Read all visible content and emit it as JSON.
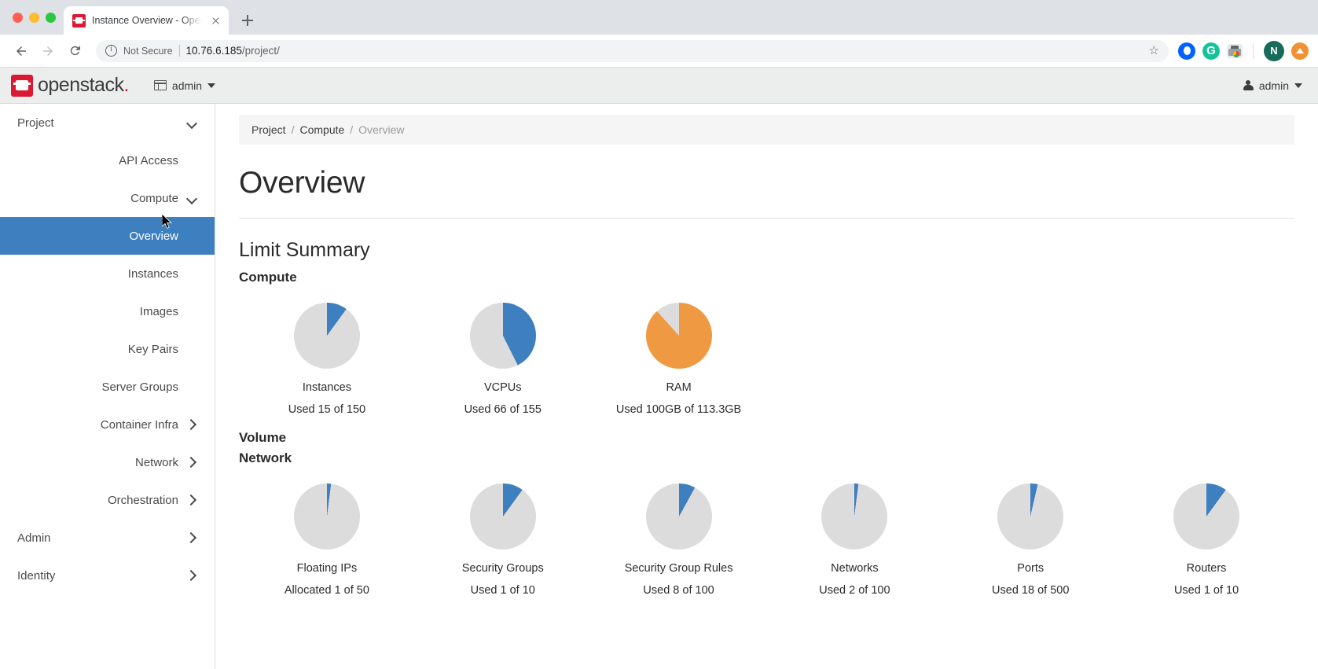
{
  "browser": {
    "tab": {
      "title": "Instance Overview - OpenStack",
      "favicon_name": "openstack-favicon",
      "close_label": "Close tab"
    },
    "new_tab_label": "New Tab",
    "toolbar": {
      "back_label": "Back",
      "forward_label": "Forward",
      "reload_label": "Reload",
      "security_text": "Not Secure",
      "url_host": "10.76.6.185",
      "url_path": "/project/",
      "bookmark_label": "Bookmark this tab",
      "extensions": [
        {
          "name": "opera-extension-icon",
          "label": "Opera"
        },
        {
          "name": "grammarly-extension-icon",
          "label": "G"
        },
        {
          "name": "print-friendly-extension-icon",
          "label": "Print"
        }
      ],
      "profile_initial": "N",
      "update_label": "Update"
    }
  },
  "app_header": {
    "logo_text": "openstack",
    "logo_dot": ".",
    "project_switcher": "admin",
    "user_menu": "admin"
  },
  "sidebar": {
    "items": [
      {
        "label": "Project",
        "level": 0,
        "icon": "chevron-down-icon",
        "active": false,
        "name": "sidebar-item-project"
      },
      {
        "label": "API Access",
        "level": 1,
        "icon": "none",
        "active": false,
        "name": "sidebar-item-api-access"
      },
      {
        "label": "Compute",
        "level": 1,
        "icon": "chevron-down-icon",
        "active": false,
        "name": "sidebar-item-compute"
      },
      {
        "label": "Overview",
        "level": 2,
        "icon": "none",
        "active": true,
        "name": "sidebar-item-overview"
      },
      {
        "label": "Instances",
        "level": 2,
        "icon": "none",
        "active": false,
        "name": "sidebar-item-instances"
      },
      {
        "label": "Images",
        "level": 2,
        "icon": "none",
        "active": false,
        "name": "sidebar-item-images"
      },
      {
        "label": "Key Pairs",
        "level": 2,
        "icon": "none",
        "active": false,
        "name": "sidebar-item-key-pairs"
      },
      {
        "label": "Server Groups",
        "level": 2,
        "icon": "none",
        "active": false,
        "name": "sidebar-item-server-groups"
      },
      {
        "label": "Container Infra",
        "level": 1,
        "icon": "chevron-right-icon",
        "active": false,
        "name": "sidebar-item-container-infra"
      },
      {
        "label": "Network",
        "level": 1,
        "icon": "chevron-right-icon",
        "active": false,
        "name": "sidebar-item-network"
      },
      {
        "label": "Orchestration",
        "level": 1,
        "icon": "chevron-right-icon",
        "active": false,
        "name": "sidebar-item-orchestration"
      },
      {
        "label": "Admin",
        "level": 0,
        "icon": "chevron-right-icon",
        "active": false,
        "name": "sidebar-item-admin"
      },
      {
        "label": "Identity",
        "level": 0,
        "icon": "chevron-right-icon",
        "active": false,
        "name": "sidebar-item-identity"
      }
    ]
  },
  "breadcrumb": {
    "items": [
      "Project",
      "Compute",
      "Overview"
    ],
    "separator": "/"
  },
  "page": {
    "title": "Overview",
    "limit_summary_title": "Limit Summary",
    "sections": {
      "compute": "Compute",
      "volume": "Volume",
      "network": "Network"
    }
  },
  "colors": {
    "used_blue": "#3d7fbf",
    "used_orange": "#ef9a42",
    "remaining_gray": "#dcdcdc",
    "active_nav": "#3d7fbf"
  },
  "chart_data": [
    {
      "type": "pie",
      "title": "Compute",
      "charts": [
        {
          "label": "Instances",
          "usage_text": "Used 15 of 150",
          "used": 15,
          "total": 150,
          "percent": 10.0,
          "color": "#3d7fbf"
        },
        {
          "label": "VCPUs",
          "usage_text": "Used 66 of 155",
          "used": 66,
          "total": 155,
          "percent": 42.6,
          "color": "#3d7fbf"
        },
        {
          "label": "RAM",
          "usage_text": "Used 100GB of 113.3GB",
          "used": 100,
          "total": 113.3,
          "percent": 88.3,
          "color": "#ef9a42"
        }
      ]
    },
    {
      "type": "pie",
      "title": "Volume",
      "charts": []
    },
    {
      "type": "pie",
      "title": "Network",
      "charts": [
        {
          "label": "Floating IPs",
          "usage_text": "Allocated 1 of 50",
          "used": 1,
          "total": 50,
          "percent": 2.0,
          "color": "#3d7fbf"
        },
        {
          "label": "Security Groups",
          "usage_text": "Used 1 of 10",
          "used": 1,
          "total": 10,
          "percent": 10.0,
          "color": "#3d7fbf"
        },
        {
          "label": "Security Group Rules",
          "usage_text": "Used 8 of 100",
          "used": 8,
          "total": 100,
          "percent": 8.0,
          "color": "#3d7fbf"
        },
        {
          "label": "Networks",
          "usage_text": "Used 2 of 100",
          "used": 2,
          "total": 100,
          "percent": 2.0,
          "color": "#3d7fbf"
        },
        {
          "label": "Ports",
          "usage_text": "Used 18 of 500",
          "used": 18,
          "total": 500,
          "percent": 3.6,
          "color": "#3d7fbf"
        },
        {
          "label": "Routers",
          "usage_text": "Used 1 of 10",
          "used": 1,
          "total": 10,
          "percent": 10.0,
          "color": "#3d7fbf"
        }
      ]
    }
  ]
}
